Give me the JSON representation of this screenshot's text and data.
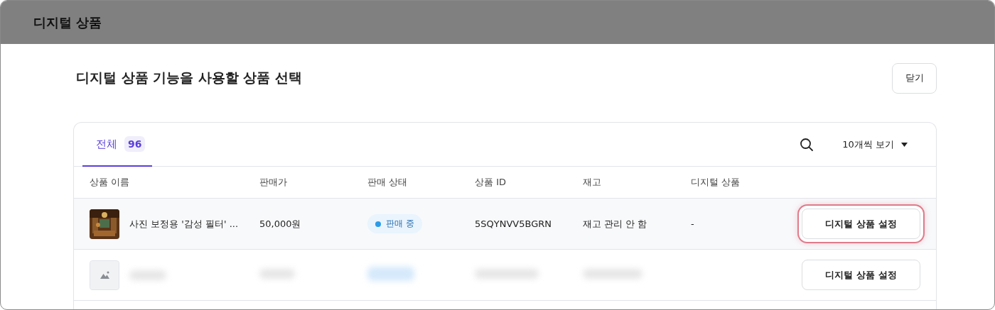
{
  "window": {
    "title": "디지털 상품"
  },
  "heading": "디지털 상품 기능을 사용할 상품 선택",
  "close_button": "닫기",
  "tabs": [
    {
      "label": "전체",
      "count": "96",
      "selected": true
    }
  ],
  "page_size": "10개씩 보기",
  "table": {
    "columns": [
      "상품 이름",
      "판매가",
      "판매 상태",
      "상품 ID",
      "재고",
      "디지털 상품"
    ],
    "rows": [
      {
        "kind": "product",
        "highlighted": true,
        "name": "사진 보정용 '감성 필터' ...",
        "price": "50,000원",
        "status": "판매 중",
        "color": "#2b9be8",
        "id": "5SQYNVV5BGRN",
        "stock": "재고 관리 안 함",
        "digital": "-",
        "action": "디지털 상품 설정"
      },
      {
        "kind": "blurred",
        "highlighted": false,
        "action": "디지털 상품 설정"
      }
    ]
  }
}
